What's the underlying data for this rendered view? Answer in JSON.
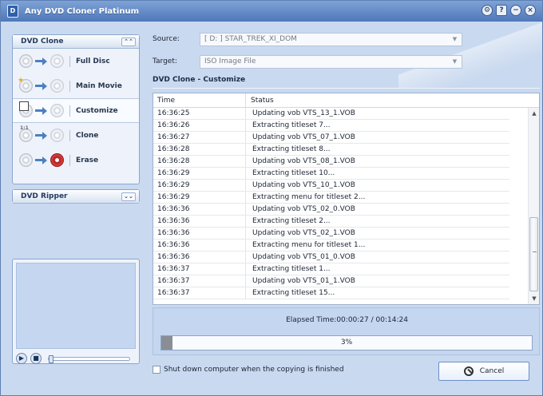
{
  "window": {
    "title": "Any DVD Cloner Platinum",
    "icon": "D"
  },
  "sidebar": {
    "dvd_clone_label": "DVD Clone",
    "collapse_up": "⌃⌃",
    "nav_items": [
      {
        "label": "Full Disc",
        "icon": "full-disc-icon"
      },
      {
        "label": "Main Movie",
        "icon": "main-movie-icon"
      },
      {
        "label": "Customize",
        "icon": "customize-icon"
      },
      {
        "label": "Clone",
        "icon": "clone-icon"
      },
      {
        "label": "Erase",
        "icon": "erase-icon"
      }
    ],
    "dvd_ripper_label": "DVD Ripper",
    "collapse_down": "⌄⌄"
  },
  "player": {
    "play": "▶",
    "stop": "■"
  },
  "main": {
    "source_label": "Source:",
    "source_value": "[ D: ] STAR_TREK_XI_DOM",
    "target_label": "Target:",
    "target_value": "ISO Image File",
    "section_title": "DVD Clone - Customize",
    "table": {
      "headers": [
        "Time",
        "Status"
      ],
      "rows": [
        [
          "16:36:25",
          "Updating vob VTS_13_1.VOB"
        ],
        [
          "16:36:26",
          "Extracting titleset 7..."
        ],
        [
          "16:36:27",
          "Updating vob VTS_07_1.VOB"
        ],
        [
          "16:36:28",
          "Extracting titleset 8..."
        ],
        [
          "16:36:28",
          "Updating vob VTS_08_1.VOB"
        ],
        [
          "16:36:29",
          "Extracting titleset 10..."
        ],
        [
          "16:36:29",
          "Updating vob VTS_10_1.VOB"
        ],
        [
          "16:36:29",
          "Extracting menu for titleset 2..."
        ],
        [
          "16:36:36",
          "Updating vob VTS_02_0.VOB"
        ],
        [
          "16:36:36",
          "Extracting titleset 2..."
        ],
        [
          "16:36:36",
          "Updating vob VTS_02_1.VOB"
        ],
        [
          "16:36:36",
          "Extracting menu for titleset 1..."
        ],
        [
          "16:36:36",
          "Updating vob VTS_01_0.VOB"
        ],
        [
          "16:36:37",
          "Extracting titleset 1..."
        ],
        [
          "16:36:37",
          "Updating vob VTS_01_1.VOB"
        ],
        [
          "16:36:37",
          "Extracting titleset 15..."
        ]
      ]
    },
    "elapsed_time": "Elapsed Time:00:00:27 / 00:14:24",
    "progress": {
      "percent": 3,
      "label": "3%"
    },
    "shutdown_label": "Shut down computer when the copying is finished",
    "cancel_label": "Cancel"
  }
}
